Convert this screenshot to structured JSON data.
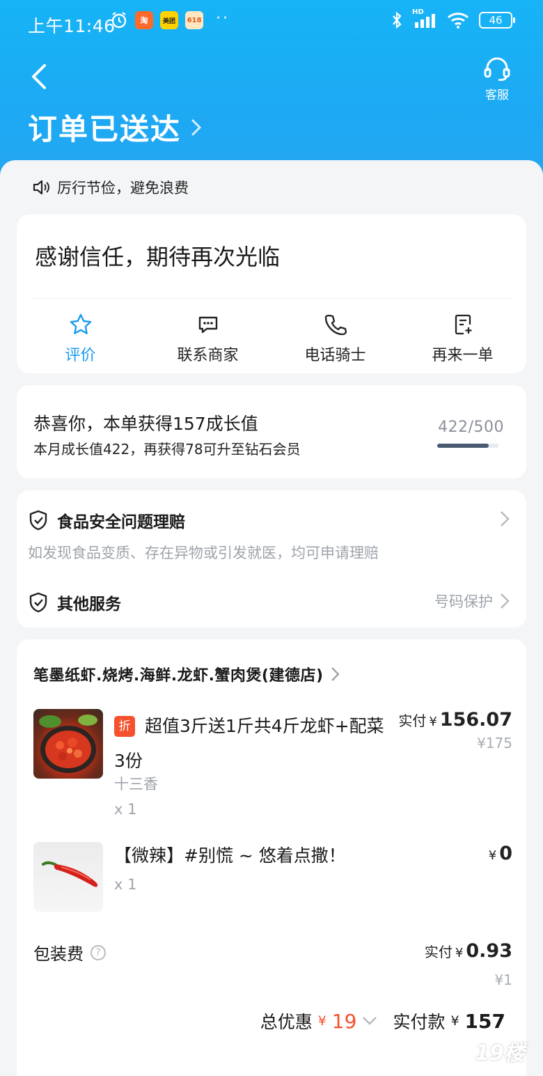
{
  "status_bar": {
    "time": "上午11:46",
    "battery": "46",
    "network": "HD",
    "app_meituan": "美团",
    "app_618": "618"
  },
  "header": {
    "title": "订单已送达",
    "service_label": "客服"
  },
  "notice": "厉行节俭，避免浪费",
  "thanks_card": {
    "message": "感谢信任，期待再次光临",
    "actions": [
      {
        "label": "评价",
        "icon": "star-icon"
      },
      {
        "label": "联系商家",
        "icon": "chat-icon"
      },
      {
        "label": "电话骑士",
        "icon": "phone-icon"
      },
      {
        "label": "再来一单",
        "icon": "reorder-icon"
      }
    ]
  },
  "growth": {
    "title": "恭喜你，本单获得157成长值",
    "subtitle": "本月成长值422，再获得78可升至钻石会员",
    "progress_text": "422/500",
    "progress_fraction": 0.844
  },
  "safety": {
    "title": "食品安全问题理赔",
    "desc": "如发现食品变质、存在异物或引发就医，均可申请理赔",
    "other_title": "其他服务",
    "other_right": "号码保护"
  },
  "order": {
    "shop_name": "笔墨纸虾.烧烤.海鲜.龙虾.蟹肉煲(建德店)",
    "items": [
      {
        "badge": "折",
        "name": "超值3斤送1斤共4斤龙虾+配菜3份",
        "spec": "十三香",
        "qty": "x 1",
        "paid_label": "实付",
        "currency": "¥",
        "paid": "156.07",
        "original": "¥175"
      },
      {
        "name": "【微辣】#别慌 ~ 悠着点撒！",
        "qty": "x 1",
        "currency": "¥",
        "paid": "0"
      }
    ],
    "packing": {
      "label": "包装费",
      "help_icon": "?",
      "paid_label": "实付",
      "currency": "¥",
      "paid": "0.93",
      "original": "¥1"
    },
    "total": {
      "discount_label": "总优惠",
      "discount_currency": "¥",
      "discount": "19",
      "paid_label": "实付款",
      "currency": "¥",
      "paid": "157"
    }
  },
  "watermark": "19楼",
  "colors": {
    "header": "#1ea8f3",
    "accent": "#1a9bf0",
    "discount": "#f4512c"
  }
}
